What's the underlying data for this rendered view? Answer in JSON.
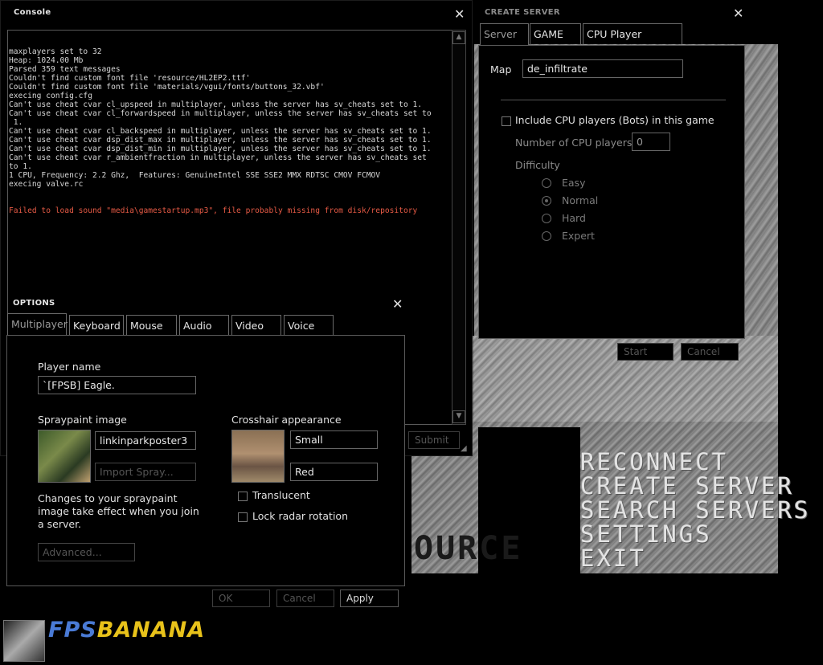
{
  "console": {
    "title": "Console",
    "close": "✕",
    "lines": [
      "maxplayers set to 32",
      "Heap: 1024.00 Mb",
      "Parsed 359 text messages",
      "Couldn't find custom font file 'resource/HL2EP2.ttf'",
      "Couldn't find custom font file 'materials/vgui/fonts/buttons_32.vbf'",
      "execing config.cfg",
      "Can't use cheat cvar cl_upspeed in multiplayer, unless the server has sv_cheats set to 1.",
      "Can't use cheat cvar cl_forwardspeed in multiplayer, unless the server has sv_cheats set to\n 1.",
      "Can't use cheat cvar cl_backspeed in multiplayer, unless the server has sv_cheats set to 1.",
      "Can't use cheat cvar dsp_dist_max in multiplayer, unless the server has sv_cheats set to 1.",
      "Can't use cheat cvar dsp_dist_min in multiplayer, unless the server has sv_cheats set to 1.",
      "Can't use cheat cvar r_ambientfraction in multiplayer, unless the server has sv_cheats set\nto 1.",
      "1 CPU, Frequency: 2.2 Ghz,  Features: GenuineIntel SSE SSE2 MMX RDTSC CMOV FCMOV",
      "execing valve.rc"
    ],
    "error_line": "Failed to load sound \"media\\gamestartup.mp3\", file probably missing from disk/repository",
    "submit_label": "Submit"
  },
  "create_server": {
    "title": "CREATE SERVER",
    "close": "✕",
    "tabs": [
      "Server",
      "GAME",
      "CPU Player Options"
    ],
    "map_label": "Map",
    "map_value": "de_infiltrate",
    "include_bots_label": "Include CPU players (Bots) in this game",
    "num_cpu_label": "Number of CPU players",
    "num_cpu_value": "0",
    "difficulty_label": "Difficulty",
    "difficulty_options": [
      "Easy",
      "Normal",
      "Hard",
      "Expert"
    ],
    "difficulty_selected": "Normal",
    "start_label": "Start",
    "cancel_label": "Cancel"
  },
  "options": {
    "title": "OPTIONS",
    "close": "✕",
    "tabs": [
      "Multiplayer",
      "Keyboard",
      "Mouse",
      "Audio",
      "Video",
      "Voice"
    ],
    "player_name_label": "Player name",
    "player_name_value": "`[FPSB] Eagle.",
    "spraypaint_label": "Spraypaint image",
    "spray_value": "linkinparkposter3",
    "import_spray_label": "Import Spray...",
    "spray_note": "Changes to your spraypaint image take effect when you join a server.",
    "advanced_label": "Advanced...",
    "crosshair_label": "Crosshair appearance",
    "crosshair_size": "Small",
    "crosshair_color": "Red",
    "translucent_label": "Translucent",
    "lock_radar_label": "Lock radar rotation",
    "ok_label": "OK",
    "cancel_label": "Cancel",
    "apply_label": "Apply"
  },
  "main_menu": {
    "items": [
      "RECONNECT",
      "CREATE SERVER",
      "SEARCH SERVERS",
      "SETTINGS",
      "EXIT"
    ],
    "logo_text": "OURCE"
  },
  "watermark": {
    "fps": "FPS",
    "banana": "BANANA",
    "fps_color": "#4a7bd6",
    "banana_color": "#e8c21a"
  }
}
